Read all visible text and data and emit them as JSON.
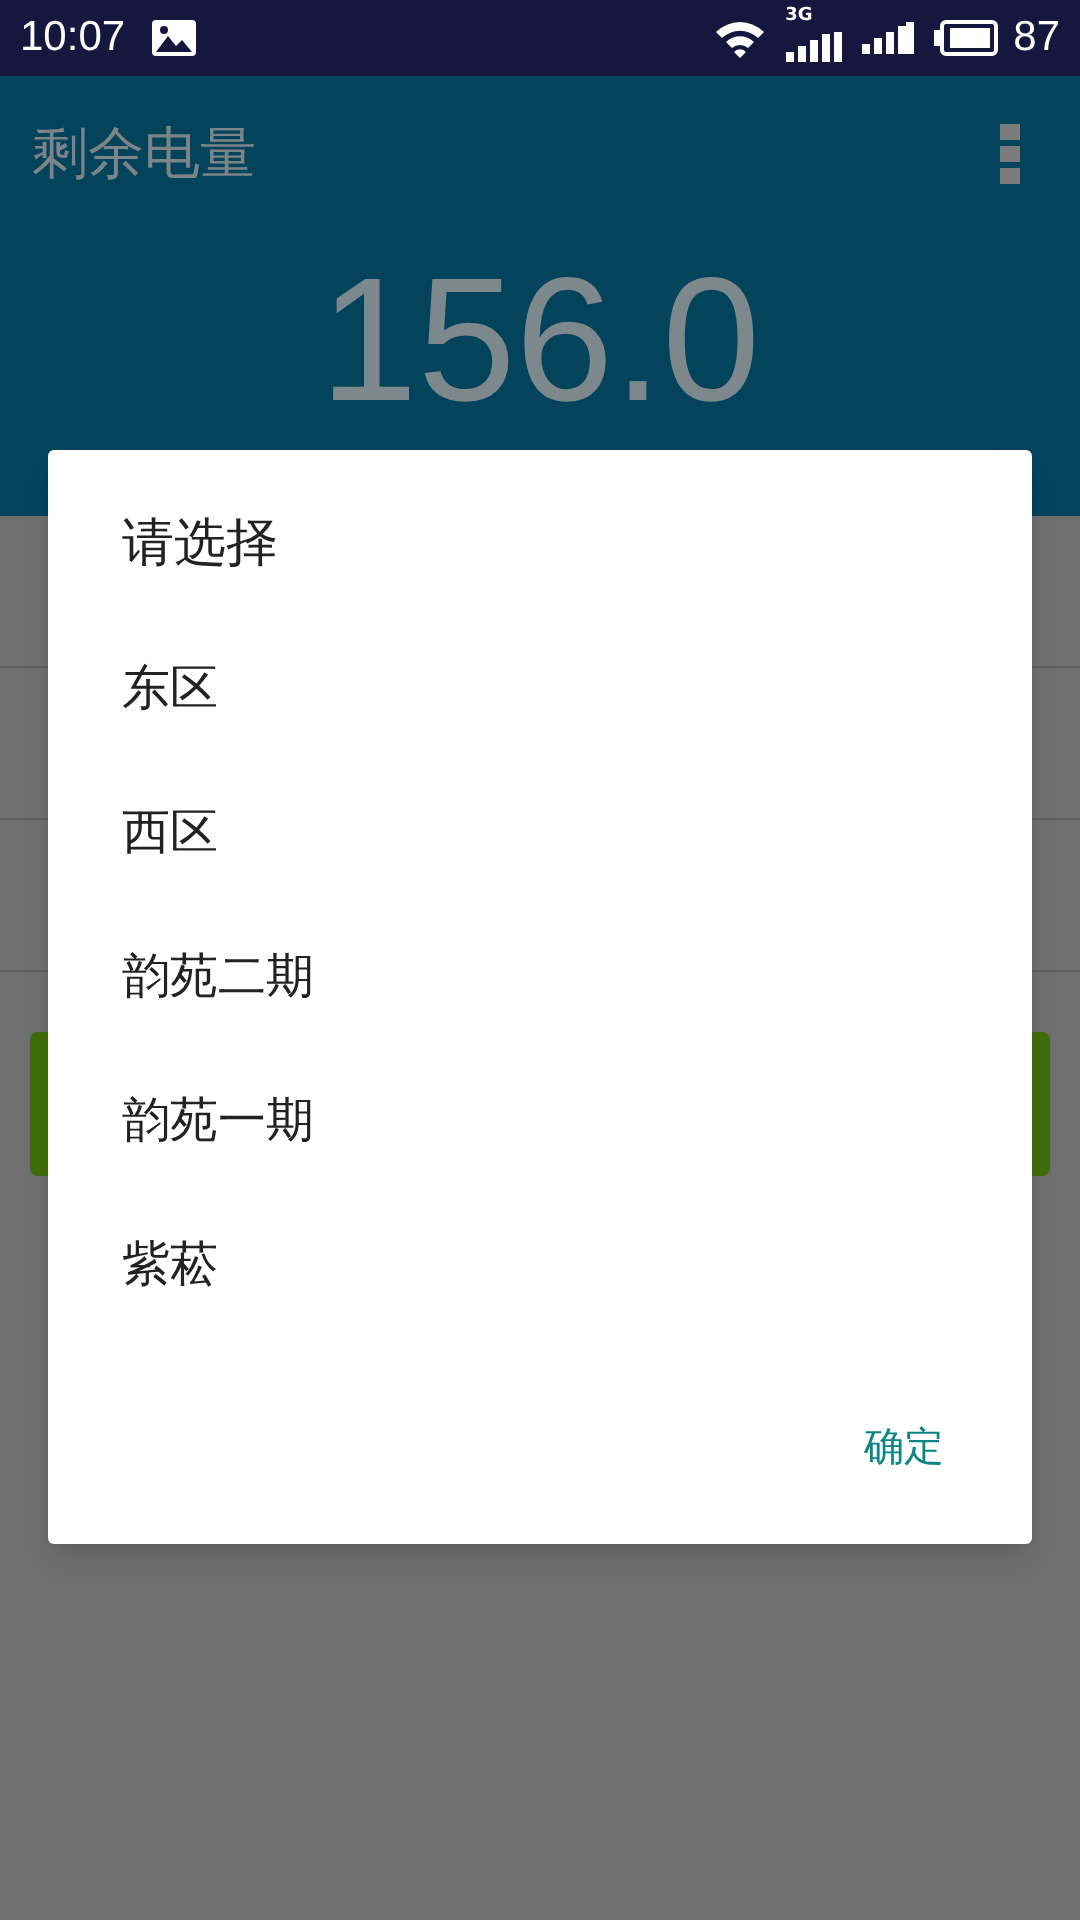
{
  "status_bar": {
    "time": "10:07",
    "network_type": "3G",
    "battery": "87"
  },
  "app_bar": {
    "title": "剩余电量"
  },
  "reading": "156.0",
  "dialog": {
    "title": "请选择",
    "options": [
      {
        "label": "东区"
      },
      {
        "label": "西区"
      },
      {
        "label": "韵苑二期"
      },
      {
        "label": "韵苑一期"
      },
      {
        "label": "紫菘"
      }
    ],
    "confirm": "确定"
  }
}
